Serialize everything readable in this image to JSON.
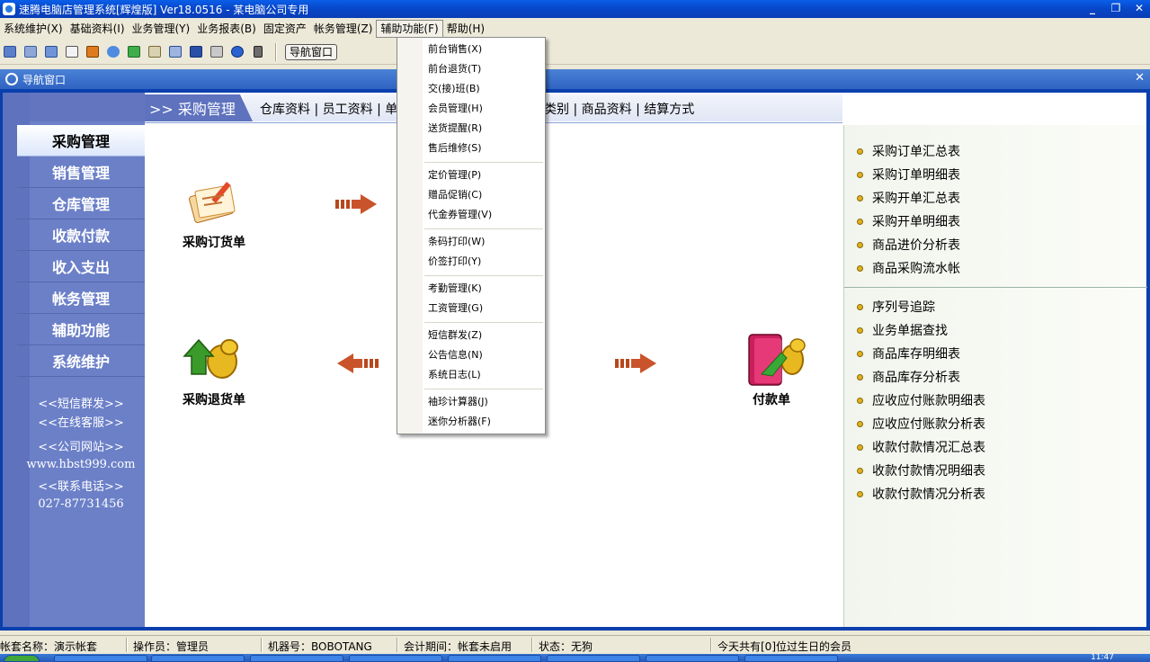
{
  "window": {
    "title": "速腾电脑店管理系统[辉煌版] Ver18.0516  -  某电脑公司专用",
    "controls": [
      "_",
      "❐",
      "✕"
    ]
  },
  "menubar": {
    "items": [
      "系统维护(X)",
      "基础资料(I)",
      "业务管理(Y)",
      "业务报表(B)",
      "固定资产",
      "帐务管理(Z)",
      "辅助功能(F)",
      "帮助(H)"
    ]
  },
  "toolbar": {
    "icons": [
      "table-icon",
      "form-icon",
      "window-icon",
      "message-icon",
      "network-icon",
      "user-icon",
      "save-doc-icon",
      "edit-icon",
      "card-icon",
      "floppy-icon",
      "printer-icon",
      "help-icon",
      "exit-icon"
    ],
    "nav_button": "导航窗口"
  },
  "child": {
    "title": "导航窗口",
    "close": "✕"
  },
  "leftnav": {
    "items": [
      "采购管理",
      "销售管理",
      "仓库管理",
      "收款付款",
      "收入支出",
      "帐务管理",
      "辅助功能",
      "系统维护"
    ],
    "links": [
      "<<短信群发>>",
      "<<在线客服>>",
      "<<公司网站>>",
      "www.hbst999.com",
      "<<联系电话>>",
      "027-87731456"
    ]
  },
  "tabs": {
    "current": ">> 采购管理",
    "links_left": "仓库资料 | 员工资料 | 单",
    "links_right": "类别 | 商品资料 | 结算方式"
  },
  "flow": {
    "purchase_order": "采购订货单",
    "purchase_return": "采购退货单",
    "payment": "付款单"
  },
  "reports": {
    "group1": [
      "采购订单汇总表",
      "采购订单明细表",
      "采购开单汇总表",
      "采购开单明细表",
      "商品进价分析表",
      "商品采购流水帐"
    ],
    "group2": [
      "序列号追踪",
      "业务单据查找",
      "商品库存明细表",
      "商品库存分析表",
      "应收应付账款明细表",
      "应收应付账款分析表",
      "收款付款情况汇总表",
      "收款付款情况明细表",
      "收款付款情况分析表"
    ]
  },
  "dropdown": {
    "groups": [
      [
        "前台销售(X)",
        "前台退货(T)",
        "交(接)班(B)",
        "会员管理(H)",
        "送货提醒(R)",
        "售后维修(S)"
      ],
      [
        "定价管理(P)",
        "赠品促销(C)",
        "代金券管理(V)"
      ],
      [
        "条码打印(W)",
        "价签打印(Y)"
      ],
      [
        "考勤管理(K)",
        "工资管理(G)"
      ],
      [
        "短信群发(Z)",
        "公告信息(N)",
        "系统日志(L)"
      ],
      [
        "袖珍计算器(J)",
        "迷你分析器(F)"
      ]
    ]
  },
  "statusbar": {
    "account": "帐套名称：演示帐套",
    "operator": "操作员：管理员",
    "machine": "机器号：BOBOTANG",
    "period": "会计期间：帐套未启用",
    "state": "状态：无狗",
    "birthday": "今天共有[0]位过生日的会员"
  },
  "taskbar": {
    "clock": "11:47"
  }
}
